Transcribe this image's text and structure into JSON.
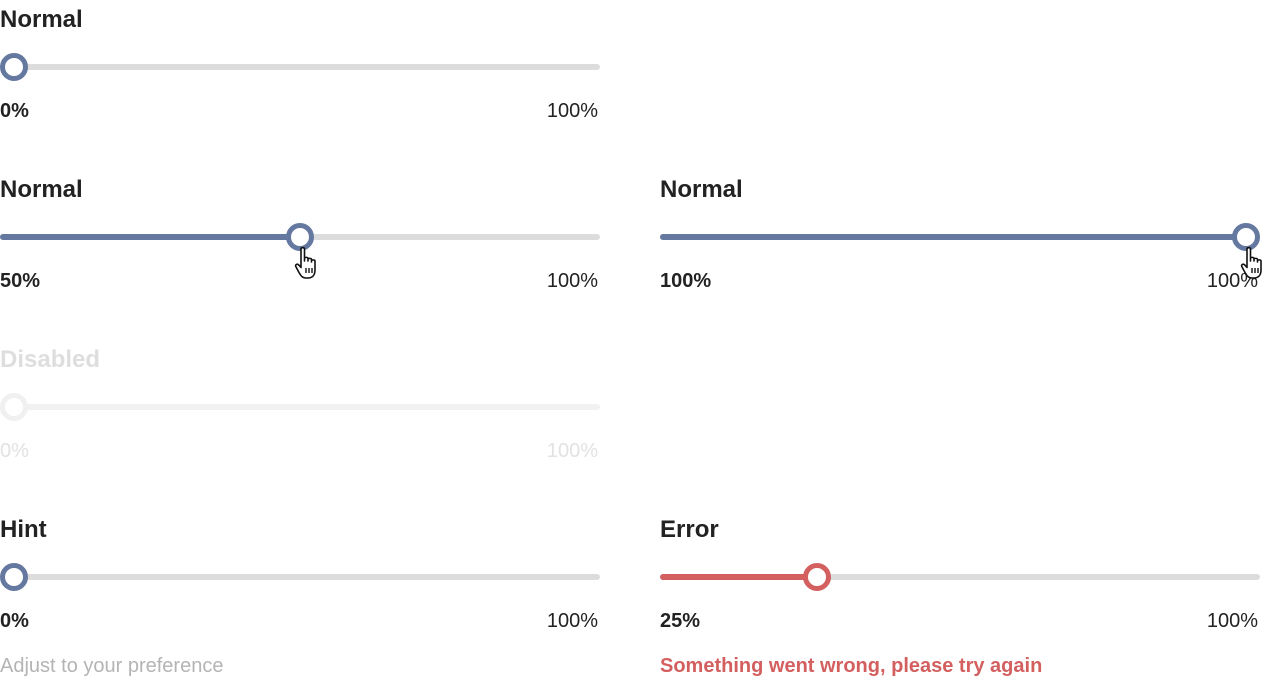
{
  "colors": {
    "accent": "#6478a0",
    "error": "#d35f5f",
    "track": "#dcdcdc",
    "hint_text": "#b4b4b4"
  },
  "sliders": [
    {
      "id": "s1",
      "title": "Normal",
      "value": 0,
      "value_label": "0%",
      "max_label": "100%",
      "state": "normal"
    },
    {
      "id": "s2",
      "title": "Normal",
      "value": 50,
      "value_label": "50%",
      "max_label": "100%",
      "state": "hover"
    },
    {
      "id": "s3",
      "title": "Normal",
      "value": 100,
      "value_label": "100%",
      "max_label": "100%",
      "state": "hover"
    },
    {
      "id": "s4",
      "title": "Disabled",
      "value": 0,
      "value_label": "0%",
      "max_label": "100%",
      "state": "disabled"
    },
    {
      "id": "s5",
      "title": "Hint",
      "value": 0,
      "value_label": "0%",
      "max_label": "100%",
      "state": "normal",
      "hint": "Adjust to your preference"
    },
    {
      "id": "s6",
      "title": "Error",
      "value": 25,
      "value_label": "25%",
      "max_label": "100%",
      "state": "error",
      "error": "Something went wrong, please try again"
    }
  ],
  "icons": {
    "cursor": "hand-pointer-icon"
  }
}
